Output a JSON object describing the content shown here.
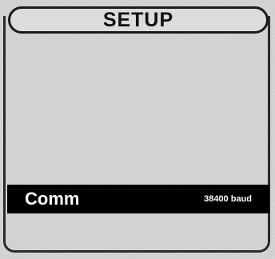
{
  "header": {
    "title": "SETUP"
  },
  "menu": {
    "selected_item": {
      "label": "Comm",
      "value": "38400 baud"
    }
  },
  "colors": {
    "screen_background": "#d6d6d6",
    "foreground": "#111111",
    "highlight_background": "#000000",
    "highlight_text": "#ffffff"
  }
}
